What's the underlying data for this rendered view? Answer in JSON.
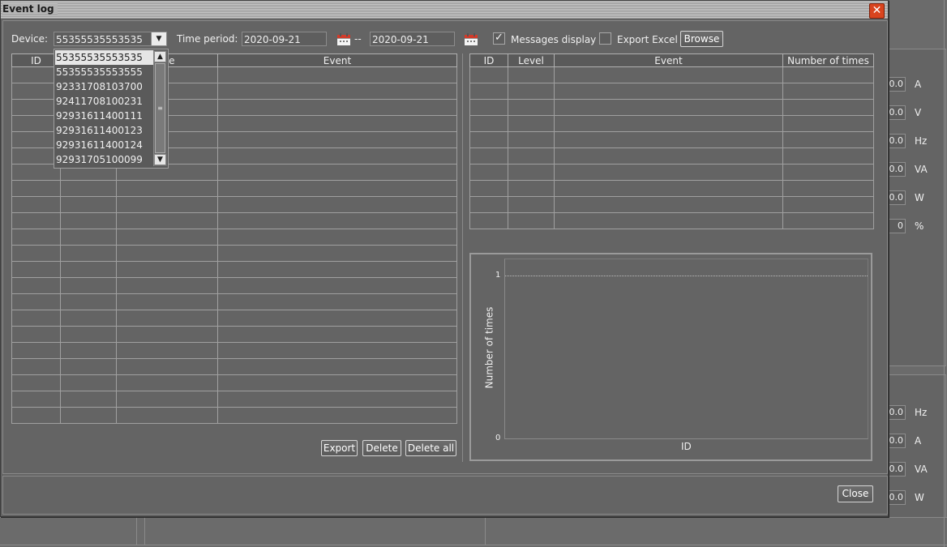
{
  "window": {
    "title": "Event log",
    "close_glyph": "✕"
  },
  "toolbar": {
    "device_label": "Device:",
    "device_value": "55355535553535",
    "time_period_label": "Time period:",
    "start_date": "2020-09-21",
    "date_separator": "--",
    "end_date": "2020-09-21",
    "messages_display_label": "Messages display",
    "messages_display_checked": true,
    "check_glyph": "✓",
    "export_excel_label": "Export Excel",
    "export_excel_checked": false,
    "browse_label": "Browse"
  },
  "device_dropdown": {
    "options": [
      "55355535553535",
      "55355535553555",
      "92331708103700",
      "92411708100231",
      "92931611400111",
      "92931611400123",
      "92931611400124",
      "92931705100099"
    ],
    "selected_index": 0,
    "scroll_up_glyph": "▲",
    "scroll_down_glyph": "▼",
    "thumb_glyph": "≡",
    "arrow_glyph": "▼"
  },
  "left_table": {
    "columns": [
      "ID",
      "",
      "Time",
      "Event"
    ],
    "time_header_visible": "me",
    "row_count": 22
  },
  "left_actions": {
    "export_label": "Export",
    "delete_label": "Delete",
    "delete_all_label": "Delete all"
  },
  "right_table": {
    "columns": [
      "ID",
      "Level",
      "Event",
      "Number of times"
    ],
    "row_count": 10
  },
  "chart_data": {
    "type": "bar",
    "categories": [],
    "values": [],
    "xlabel": "ID",
    "ylabel": "Number of times",
    "ylim": [
      0,
      1
    ],
    "yticks": [
      "0",
      "1"
    ],
    "grid": true
  },
  "footer": {
    "close_label": "Close"
  },
  "background": {
    "units_top": [
      "A",
      "V",
      "Hz",
      "VA",
      "W",
      "%"
    ],
    "values_top": [
      "0.0",
      "0.0",
      "0.0",
      "0.0",
      "0.0",
      "0"
    ],
    "units_bottom": [
      "Hz",
      "A",
      "VA",
      "W"
    ],
    "values_bottom": [
      "0.0",
      "0.0",
      "0.0",
      "0.0"
    ]
  },
  "colors": {
    "accent_close": "#d9441e",
    "calendar_red": "#d23b2a",
    "dialog_bg": "#636363"
  }
}
